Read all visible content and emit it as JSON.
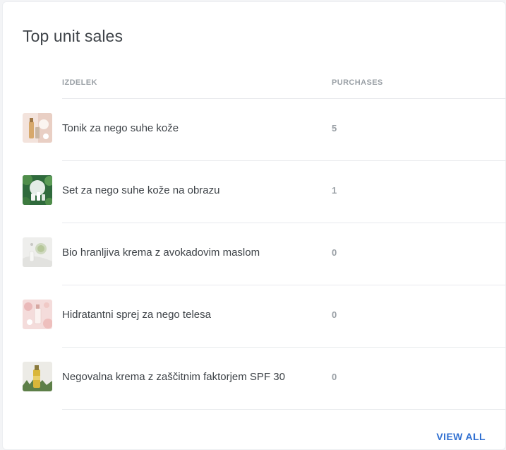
{
  "card": {
    "title": "Top unit sales"
  },
  "table": {
    "columns": {
      "product": "IZDELEK",
      "purchases": "PURCHASES"
    },
    "rows": [
      {
        "name": "Tonik za nego suhe kože",
        "purchases": "5"
      },
      {
        "name": "Set za nego suhe kože na obrazu",
        "purchases": "1"
      },
      {
        "name": "Bio hranljiva krema z avokadovim maslom",
        "purchases": "0"
      },
      {
        "name": "Hidratantni sprej za nego telesa",
        "purchases": "0"
      },
      {
        "name": "Negovalna krema z zaščitnim faktorjem SPF 30",
        "purchases": "0"
      }
    ]
  },
  "footer": {
    "view_all_label": "VIEW ALL"
  },
  "colors": {
    "link": "#2f6fd1",
    "header_text": "#9aa0a6",
    "body_text": "#3e4348"
  }
}
